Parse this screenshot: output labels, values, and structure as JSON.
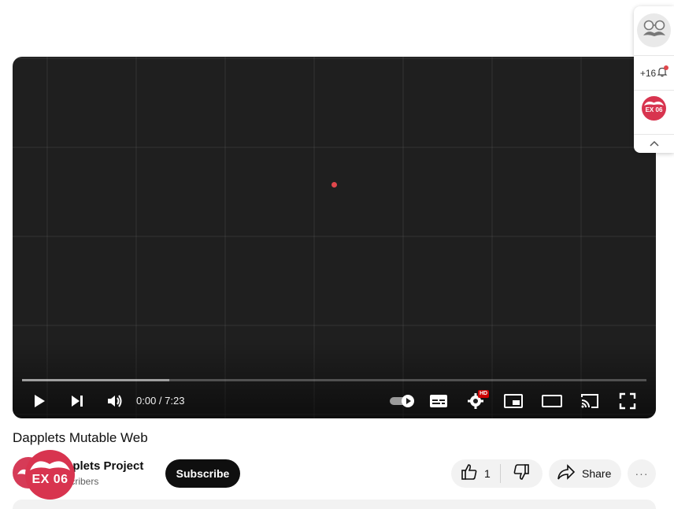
{
  "player": {
    "time_display": "0:00 / 7:23",
    "progress_fraction": 0,
    "loaded_fraction": 0.236,
    "hd_badge": "HD",
    "colors": {
      "background": "#1f1f1f",
      "accent_dot": "#e0474c"
    },
    "controls": [
      {
        "name": "play-button",
        "icon": "play-icon"
      },
      {
        "name": "next-button",
        "icon": "skip-next-icon"
      },
      {
        "name": "volume-button",
        "icon": "volume-icon"
      },
      {
        "name": "autoplay-toggle",
        "icon": "autoplay-toggle-icon"
      },
      {
        "name": "subtitles-button",
        "icon": "subtitles-icon"
      },
      {
        "name": "settings-button",
        "icon": "gear-icon"
      },
      {
        "name": "miniplayer-button",
        "icon": "miniplayer-icon"
      },
      {
        "name": "theater-mode-button",
        "icon": "theater-icon"
      },
      {
        "name": "cast-button",
        "icon": "cast-icon"
      },
      {
        "name": "fullscreen-button",
        "icon": "fullscreen-icon"
      }
    ]
  },
  "video": {
    "title": "Dapplets Mutable Web"
  },
  "channel": {
    "name": "Dapplets Project",
    "subscribers": "subscribers",
    "subscribe_label": "Subscribe"
  },
  "actions": {
    "like_count": "1",
    "share_label": "Share",
    "more_label": "···"
  },
  "overlay": {
    "badge_text": "EX 06",
    "color": "#d8344f"
  },
  "extension_panel": {
    "notification_count": "+16",
    "app_badge_text": "EX 06",
    "icons": [
      "mustache-glasses-icon",
      "bell-icon",
      "chevron-up-icon"
    ]
  }
}
